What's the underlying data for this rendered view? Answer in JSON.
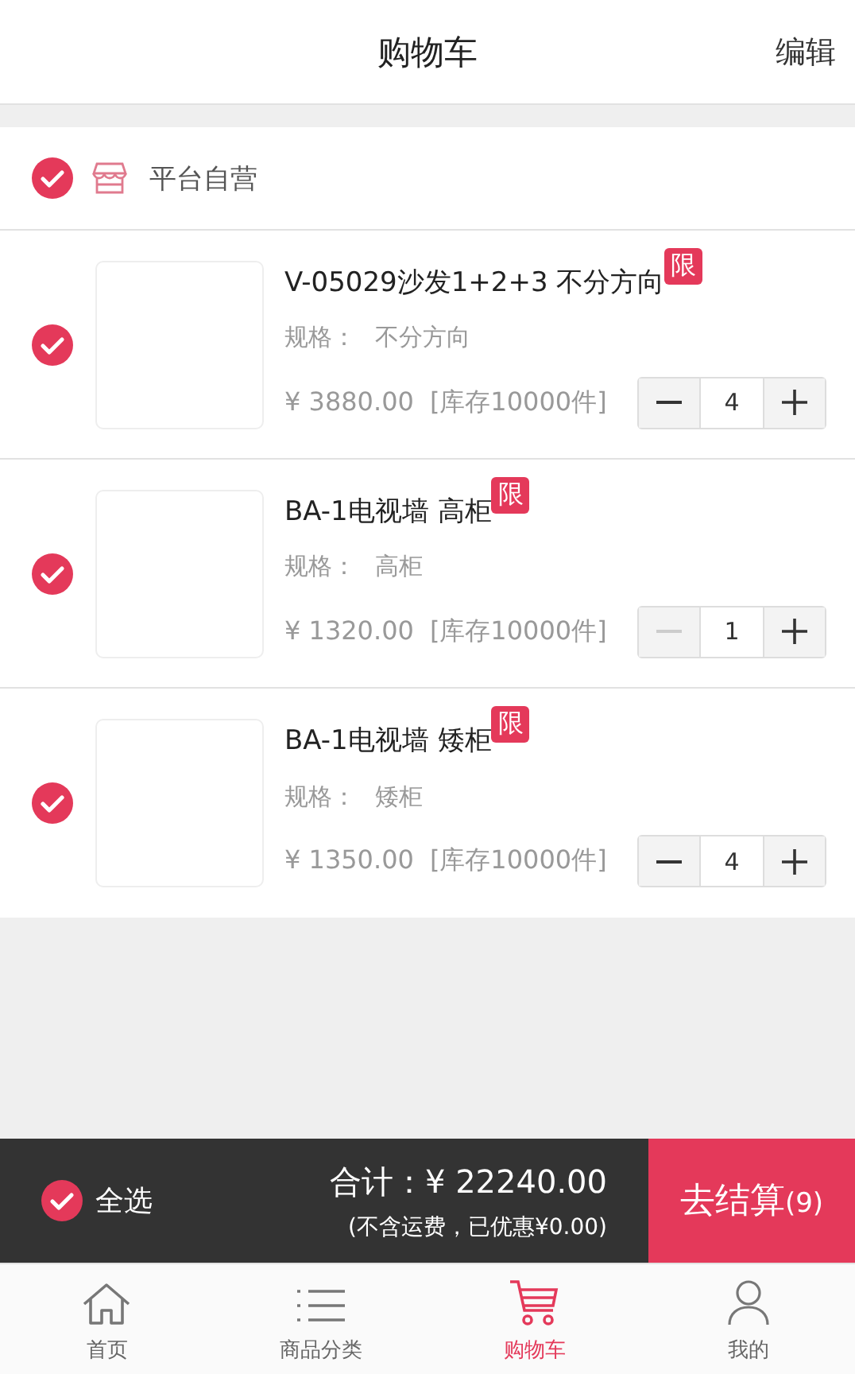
{
  "header": {
    "title": "购物车",
    "action": "编辑"
  },
  "shop": {
    "name": "平台自营",
    "checked": true
  },
  "items": [
    {
      "title": "V-05029沙发1+2+3 不分方向",
      "badge": "限",
      "spec_label": "规格：",
      "spec": "不分方向",
      "price": "¥ 3880.00",
      "stock": "[库存10000件]",
      "quantity": "4",
      "checked": true,
      "minus_disabled": false
    },
    {
      "title": "BA-1电视墙 高柜",
      "badge": "限",
      "spec_label": "规格：",
      "spec": "高柜",
      "price": "¥ 1320.00",
      "stock": "[库存10000件]",
      "quantity": "1",
      "checked": true,
      "minus_disabled": true
    },
    {
      "title": "BA-1电视墙 矮柜",
      "badge": "限",
      "spec_label": "规格：",
      "spec": "矮柜",
      "price": "¥ 1350.00",
      "stock": "[库存10000件]",
      "quantity": "4",
      "checked": true,
      "minus_disabled": false
    }
  ],
  "checkout": {
    "select_all": "全选",
    "select_all_checked": true,
    "total": "合计：¥ 22240.00",
    "note": "(不含运费，已优惠¥0.00)",
    "button": "去结算",
    "count": "(9)"
  },
  "tabs": [
    {
      "kind": "home",
      "label": "首页",
      "selected": false
    },
    {
      "kind": "list",
      "label": "商品分类",
      "selected": false
    },
    {
      "kind": "cart",
      "label": "购物车",
      "selected": true
    },
    {
      "kind": "user",
      "label": "我的",
      "selected": false
    }
  ]
}
